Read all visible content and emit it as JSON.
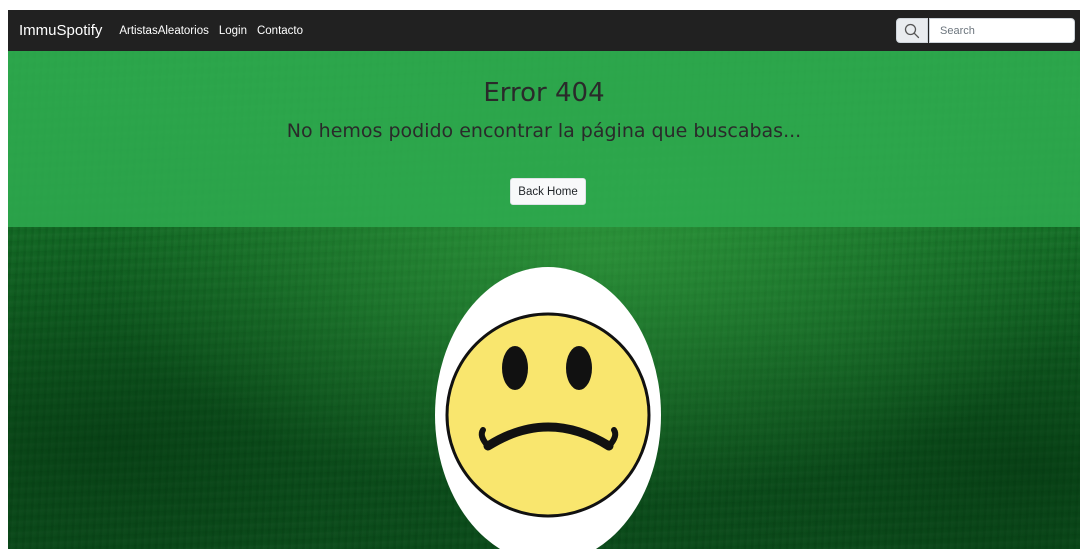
{
  "navbar": {
    "brand": "ImmuSpotify",
    "links": [
      "ArtistasAleatorios",
      "Login",
      "Contacto"
    ],
    "search": {
      "placeholder": "Search",
      "value": "",
      "icon": "search-icon"
    }
  },
  "hero": {
    "title": "Error 404",
    "subtitle": "No hemos podido encontrar la página que buscabas...",
    "button_label": "Back Home"
  },
  "illustration": {
    "name": "sad-face"
  },
  "colors": {
    "navbar_bg": "#212121",
    "hero_bg": "#2eaa4e",
    "face_yellow": "#f9e66e"
  }
}
